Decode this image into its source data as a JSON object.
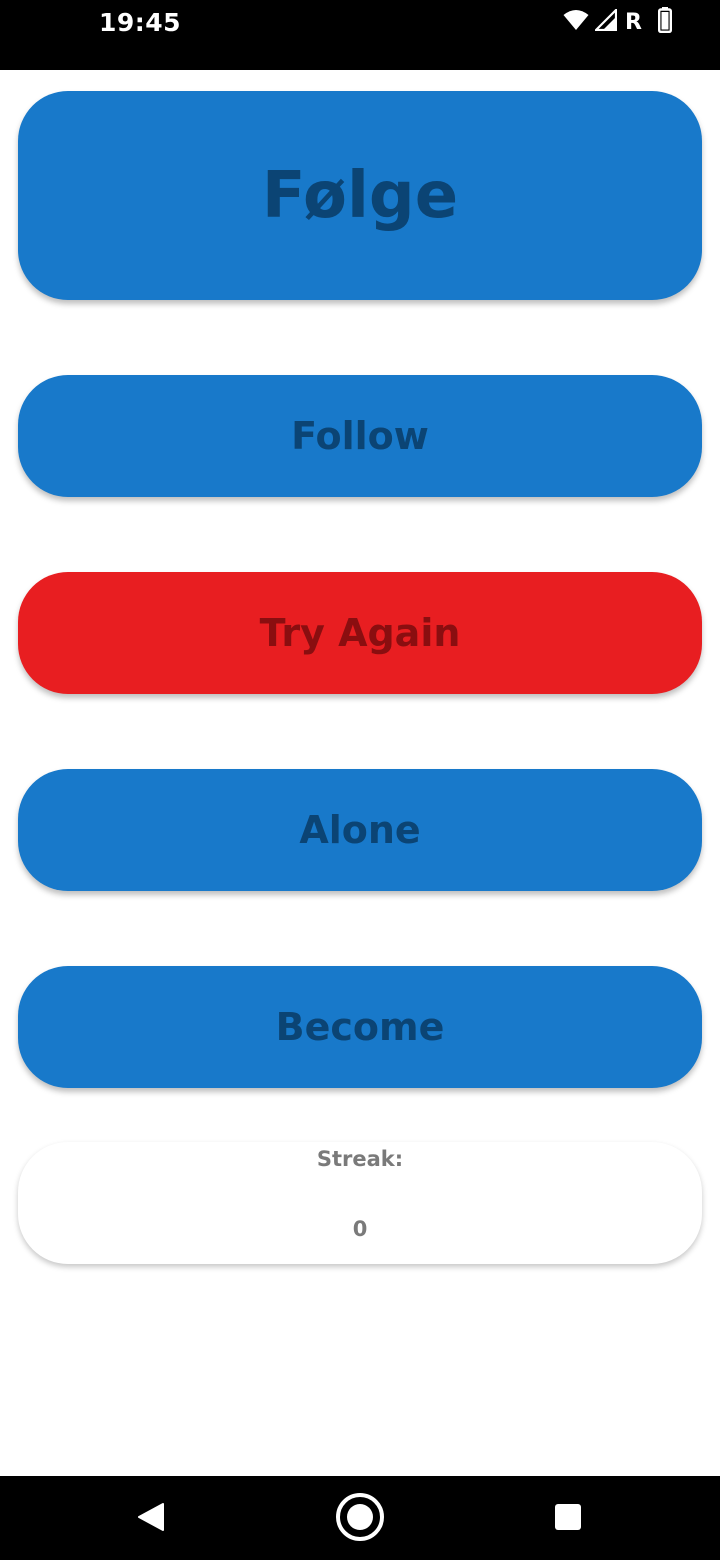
{
  "status_bar": {
    "time": "19:45",
    "network_label": "R",
    "icons": [
      "wifi-icon",
      "cell-signal-icon",
      "battery-icon"
    ]
  },
  "colors": {
    "button_blue": "#1879CA",
    "button_blue_text": "#0B4474",
    "button_red": "#E81E21",
    "button_red_text": "#8A0E10",
    "streak_text": "#7A7A7A"
  },
  "prompt": {
    "word": "Følge"
  },
  "options": [
    {
      "label": "Follow",
      "state": "neutral"
    },
    {
      "label": "Try Again",
      "state": "wrong"
    },
    {
      "label": "Alone",
      "state": "neutral"
    },
    {
      "label": "Become",
      "state": "neutral"
    }
  ],
  "streak": {
    "label": "Streak:",
    "value": "0"
  },
  "nav_bar": {
    "icons": [
      "back-icon",
      "home-icon",
      "recents-icon"
    ]
  }
}
